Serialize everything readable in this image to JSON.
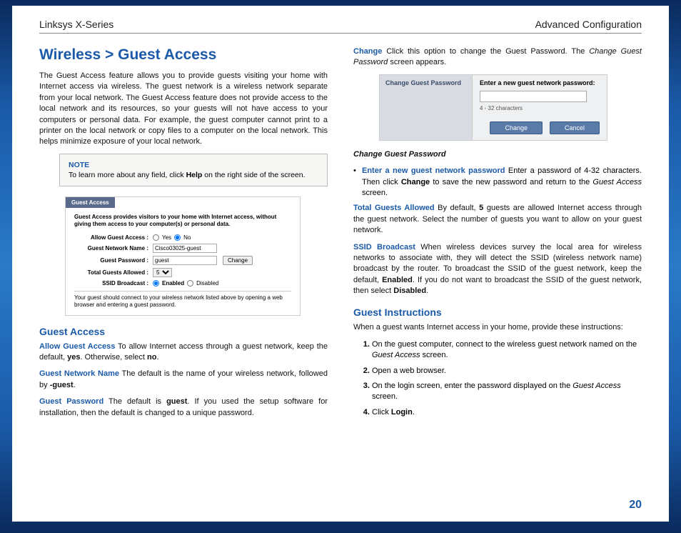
{
  "header": {
    "left": "Linksys X-Series",
    "right": "Advanced Configuration"
  },
  "title": "Wireless > Guest Access",
  "intro": "The Guest Access feature allows you to provide guests visiting your home with Internet access via wireless. The guest network is a wireless network separate from your local network. The Guest Access feature does not provide access to the local network and its resources, so your guests will not have access to your computers or personal data. For example, the guest computer cannot print to a printer on the local network or copy files to a computer on the local network. This helps minimize exposure of your local network.",
  "note": {
    "title": "NOTE",
    "text_a": "To learn more about any field, click ",
    "text_b": "Help",
    "text_c": " on the right side of the screen."
  },
  "shot1": {
    "tab": "Guest Access",
    "desc": "Guest Access provides visitors to your home with Internet access, without giving them access to your computer(s) or personal data.",
    "rows": {
      "allow": "Allow Guest Access :",
      "yes": "Yes",
      "no": "No",
      "name_label": "Guest Network Name :",
      "name_val": "Cisco03025-guest",
      "pwd_label": "Guest Password :",
      "pwd_val": "guest",
      "change": "Change",
      "total_label": "Total Guests Allowed :",
      "total_val": "5",
      "ssid_label": "SSID Broadcast :",
      "enabled": "Enabled",
      "disabled": "Disabled"
    },
    "foot": "Your guest should connect to your wireless network listed above by opening a web browser and entering a guest password."
  },
  "guest_access": {
    "heading": "Guest Access",
    "allow_term": "Allow Guest Access",
    "allow_a": "  To allow Internet access through a guest network, keep the default, ",
    "allow_b": "yes",
    "allow_c": ". Otherwise, select ",
    "allow_d": "no",
    "allow_e": ".",
    "name_term": "Guest Network Name",
    "name_a": "  The default is the name of your wireless network, followed by ",
    "name_b": "-guest",
    "name_c": ".",
    "pwd_term": "Guest Password",
    "pwd_a": "  The default is ",
    "pwd_b": "guest",
    "pwd_c": ". If you used the setup software for installation, then the default is changed to a unique password."
  },
  "col2_top": {
    "change_term": "Change",
    "change_a": "  Click this option to change the Guest Password. The ",
    "change_b": "Change Guest Password",
    "change_c": " screen appears."
  },
  "shot2": {
    "left": "Change Guest Password",
    "prompt": "Enter a new guest network password:",
    "chars": "4 - 32 characters",
    "btn_change": "Change",
    "btn_cancel": "Cancel"
  },
  "cgp": {
    "heading": "Change Guest Password",
    "bullet_term": "Enter a new guest network password",
    "bullet_a": "   Enter a password of 4-32 characters. Then click ",
    "bullet_b": "Change",
    "bullet_c": " to save the new password and return to the ",
    "bullet_d": "Guest Access",
    "bullet_e": " screen."
  },
  "total": {
    "term": "Total Guests Allowed",
    "a": "  By default, ",
    "b": "5",
    "c": " guests are allowed Internet access through the guest network. Select the number of guests you want to allow on your guest network."
  },
  "ssid": {
    "term": "SSID Broadcast",
    "a": " When wireless devices survey the local area for wireless networks to associate with, they will detect the SSID (wireless network name) broadcast by the router. To broadcast the SSID of the guest network, keep the default, ",
    "b": "Enabled",
    "c": ". If you do not want to broadcast the SSID of the guest network, then select ",
    "d": "Disabled",
    "e": "."
  },
  "instructions": {
    "heading": "Guest Instructions",
    "intro": "When a guest wants Internet access in your home, provide these instructions:",
    "s1a": "On the guest computer, connect to the wireless guest network named on the ",
    "s1b": "Guest Access",
    "s1c": " screen.",
    "s2": "Open a web browser.",
    "s3a": "On the login screen, enter the password displayed on the ",
    "s3b": "Guest Access",
    "s3c": " screen.",
    "s4a": "Click ",
    "s4b": "Login",
    "s4c": "."
  },
  "pagenum": "20"
}
